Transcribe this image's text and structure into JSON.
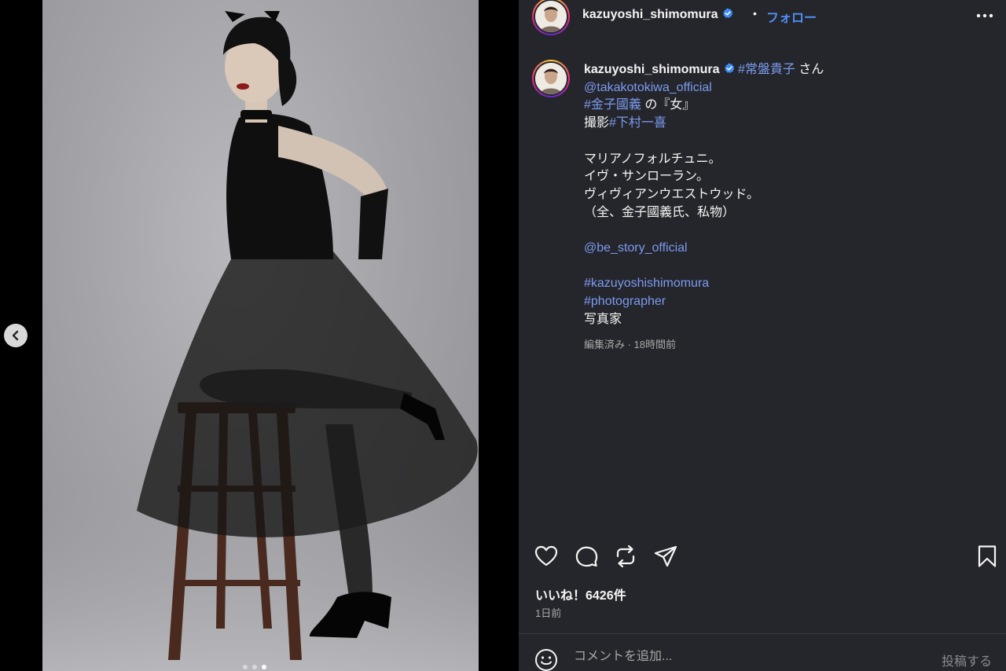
{
  "header": {
    "username": "kazuyoshi_shimomura",
    "separator": "•",
    "follow_label": "フォロー"
  },
  "caption": {
    "username": "kazuyoshi_shimomura",
    "lines": [
      [
        {
          "t": "tag",
          "v": "#常盤貴子"
        },
        {
          "t": "text",
          "v": " さん"
        }
      ],
      [
        {
          "t": "tag",
          "v": "@takakotokiwa_official"
        }
      ],
      [
        {
          "t": "tag",
          "v": "#金子國義"
        },
        {
          "t": "text",
          "v": " の『女』"
        }
      ],
      [
        {
          "t": "text",
          "v": "撮影"
        },
        {
          "t": "tag",
          "v": "#下村一喜"
        }
      ],
      [],
      [
        {
          "t": "text",
          "v": "マリアノフォルチュニ。"
        }
      ],
      [
        {
          "t": "text",
          "v": "イヴ・サンローラン。"
        }
      ],
      [
        {
          "t": "text",
          "v": "ヴィヴィアンウエストウッド。"
        }
      ],
      [
        {
          "t": "text",
          "v": "（全、金子國義氏、私物）"
        }
      ],
      [],
      [
        {
          "t": "tag",
          "v": "@be_story_official"
        }
      ],
      [],
      [
        {
          "t": "tag",
          "v": "#kazuyoshishimomura"
        }
      ],
      [
        {
          "t": "tag",
          "v": "#photographer"
        }
      ],
      [
        {
          "t": "text",
          "v": "写真家"
        }
      ]
    ],
    "meta": "編集済み · 18時間前"
  },
  "likes": "いいね！6426件",
  "time_ago": "1日前",
  "comment": {
    "placeholder": "コメントを追加...",
    "post_label": "投稿する"
  },
  "carousel": {
    "slide_count": 3,
    "active_index": 2
  },
  "icons": {
    "verified": "verified-badge-icon",
    "more": "more-options-icon",
    "like": "heart-icon",
    "comment": "comment-bubble-icon",
    "share": "repost-icon",
    "send": "paper-plane-icon",
    "save": "bookmark-icon",
    "emoji": "emoji-smile-icon",
    "prev": "chevron-left-icon"
  },
  "colors": {
    "panel_bg": "#25262b",
    "link": "#7b9bf0",
    "follow": "#4f8ff7",
    "verified": "#3d8ef7"
  }
}
